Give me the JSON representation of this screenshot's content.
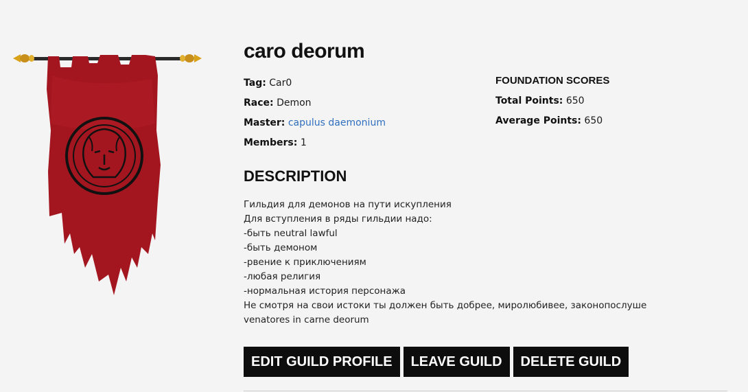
{
  "guild": {
    "name": "caro deorum",
    "tag_label": "Tag:",
    "tag": "Car0",
    "race_label": "Race:",
    "race": "Demon",
    "master_label": "Master:",
    "master": "capulus daemonium",
    "members_label": "Members:",
    "members": "1"
  },
  "scores": {
    "title": "FOUNDATION SCORES",
    "total_label": "Total Points:",
    "total": "650",
    "average_label": "Average Points:",
    "average": "650"
  },
  "description": {
    "title": "DESCRIPTION",
    "lines": [
      "Гильдия для демонов на пути искупления",
      "Для вступления в ряды гильдии надо:",
      "-быть neutral lawful",
      "-быть демоном",
      "-рвение к приключениям",
      "-любая религия",
      "-нормальная история персонажа",
      "Не смотря на свои истоки ты должен быть добрее, миролюбивее, законопослуше",
      "venatores in carne deorum"
    ]
  },
  "actions": {
    "edit": "EDIT GUILD PROFILE",
    "leave": "LEAVE GUILD",
    "delete": "DELETE GUILD"
  },
  "banner": {
    "icon": "lion-emblem-icon",
    "cloth_color": "#a3161f",
    "pole_color": "#2a2a2a",
    "finial_color": "#d9a21b"
  }
}
